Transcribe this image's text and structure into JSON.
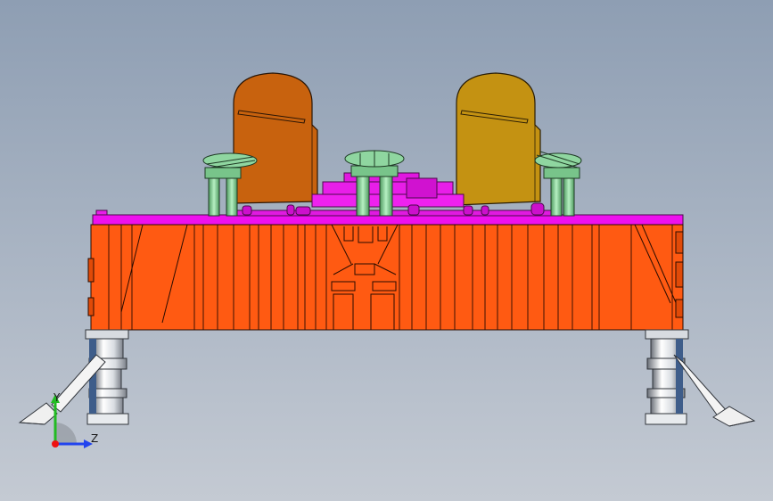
{
  "viewport": {
    "background_top": "#8e9eb3",
    "background_bottom": "#c4cad3"
  },
  "model": {
    "body_color": "#ff5a12",
    "deck_color": "#ee11ee",
    "tank_left_color": "#c8620e",
    "tank_right_color": "#c49212",
    "antenna_color": "#80cc90",
    "leg_color": "#f0f0f0"
  },
  "triad": {
    "y_label": "Y",
    "z_label": "Z",
    "x_color": "#ee1111",
    "y_color": "#22bb22",
    "z_color": "#2244ee"
  }
}
